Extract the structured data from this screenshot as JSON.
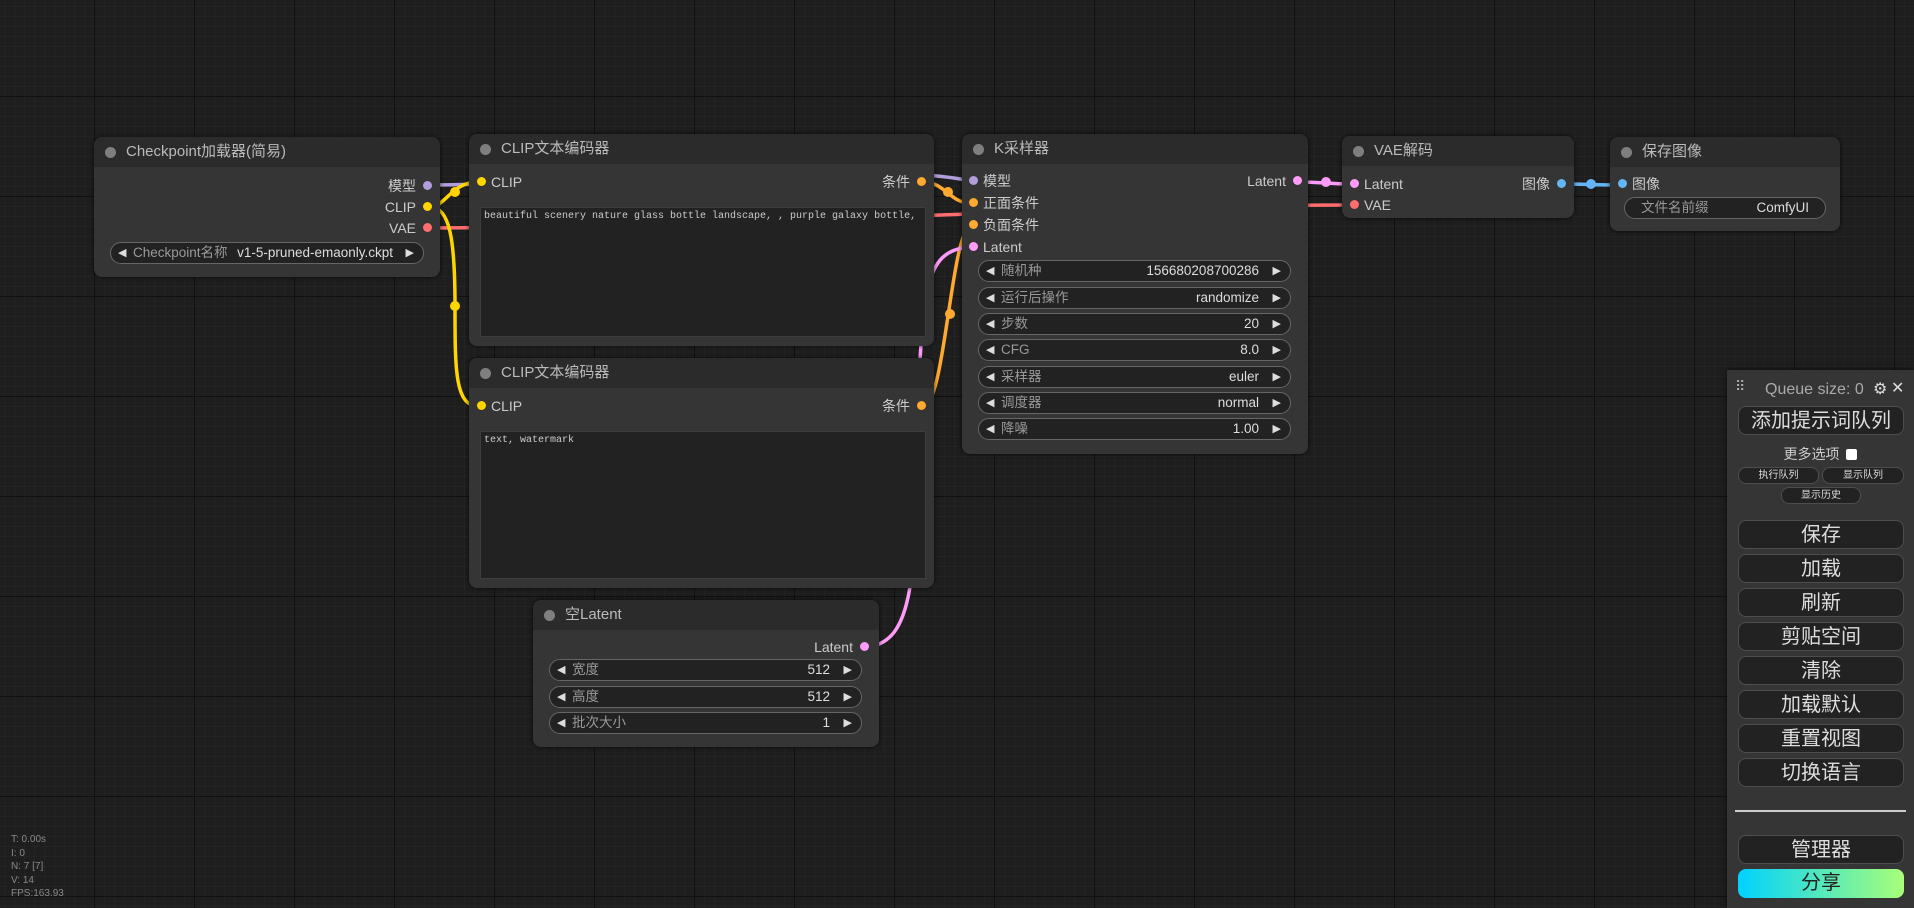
{
  "nodes": {
    "checkpoint": {
      "title": "Checkpoint加载器(简易)",
      "outputs": [
        "模型",
        "CLIP",
        "VAE"
      ],
      "widget": {
        "label": "Checkpoint名称",
        "value": "v1-5-pruned-emaonly.ckpt"
      }
    },
    "clip_pos": {
      "title": "CLIP文本编码器",
      "input": "CLIP",
      "output": "条件",
      "text": "beautiful scenery nature glass bottle landscape, , purple galaxy bottle,"
    },
    "clip_neg": {
      "title": "CLIP文本编码器",
      "input": "CLIP",
      "output": "条件",
      "text": "text, watermark"
    },
    "ksampler": {
      "title": "K采样器",
      "inputs": [
        "模型",
        "正面条件",
        "负面条件",
        "Latent"
      ],
      "output": "Latent",
      "widgets": [
        {
          "label": "随机种",
          "value": "156680208700286"
        },
        {
          "label": "运行后操作",
          "value": "randomize"
        },
        {
          "label": "步数",
          "value": "20"
        },
        {
          "label": "CFG",
          "value": "8.0"
        },
        {
          "label": "采样器",
          "value": "euler"
        },
        {
          "label": "调度器",
          "value": "normal"
        },
        {
          "label": "降噪",
          "value": "1.00"
        }
      ]
    },
    "vae_decode": {
      "title": "VAE解码",
      "inputs": [
        "Latent",
        "VAE"
      ],
      "output": "图像"
    },
    "save_image": {
      "title": "保存图像",
      "input": "图像",
      "widget": {
        "label": "文件名前缀",
        "value": "ComfyUI"
      }
    },
    "empty_latent": {
      "title": "空Latent",
      "output": "Latent",
      "widgets": [
        {
          "label": "宽度",
          "value": "512"
        },
        {
          "label": "高度",
          "value": "512"
        },
        {
          "label": "批次大小",
          "value": "1"
        }
      ]
    }
  },
  "queue_panel": {
    "queue_size": "Queue size: 0",
    "add_prompt": "添加提示词队列",
    "more_options": "更多选项",
    "run_queue": "执行队列",
    "show_queue": "显示队列",
    "show_history": "显示历史",
    "buttons": [
      "保存",
      "加载",
      "刷新",
      "剪贴空间",
      "清除",
      "加载默认",
      "重置视图",
      "切换语言"
    ],
    "manager": "管理器",
    "share": "分享"
  },
  "stats": [
    "T: 0.00s",
    "I: 0",
    "N: 7 [7]",
    "V: 14",
    "FPS:163.93"
  ],
  "colors": {
    "model": "#b39ddb",
    "clip": "#ffd500",
    "vae": "#ff6e6e",
    "conditioning": "#ffa931",
    "latent": "#ff9cf9",
    "image": "#64b5f6"
  }
}
